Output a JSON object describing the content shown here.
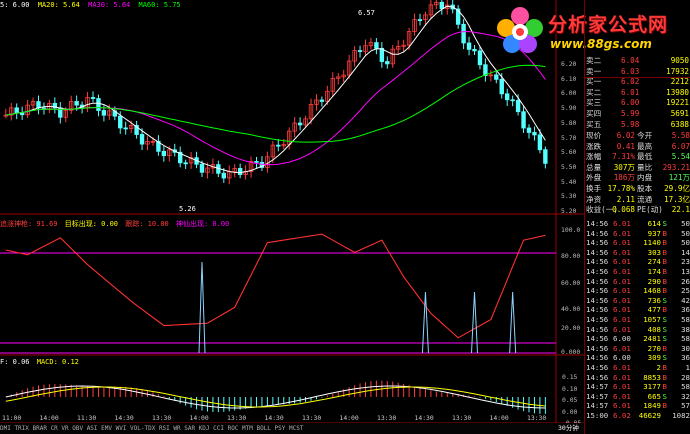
{
  "header": {
    "ma5": "5: 6.00",
    "ma20": "MA20: 5.64",
    "ma30": "MA30: 5.64",
    "ma60": "MA60: 5.75"
  },
  "annotations": {
    "high_label": "6.57",
    "low_label": "5.26"
  },
  "logo": {
    "title": "分析家公式网",
    "url": "www.88gs.com"
  },
  "main_price_axis": [
    "6.20",
    "6.10",
    "6.00",
    "5.90",
    "5.80",
    "5.70",
    "5.60",
    "5.50",
    "5.40",
    "5.30",
    "5.20"
  ],
  "ind1": {
    "label1": "追涨神枪: 91.69",
    "label2": "目标出现: 0.00",
    "label3": "跟踪: 10.00",
    "label4": "神仙出现: 0.00",
    "axis": [
      "100.0",
      "80.00",
      "60.00",
      "40.00",
      "20.00",
      "0.000"
    ]
  },
  "ind2": {
    "label1": "F: 0.06",
    "label2": "MACD: 0.12",
    "axis": [
      "0.15",
      "0.10",
      "0.05",
      "0.00",
      "-0.05"
    ]
  },
  "time_axis": [
    "11:00",
    "14:00",
    "11:30",
    "14:30",
    "13:30",
    "14:00",
    "13:30",
    "14:30",
    "13:30",
    "14:00",
    "13:30",
    "14:30",
    "13:30",
    "14:00",
    "13:30"
  ],
  "bottom_tabs": "DMI TRIX BRAR CR VR OBV ASI EMV WVI VOL-TDX RSI WR SAR KDJ CCI ROC MTM BOLL PSY MCST",
  "period_label": "30分钟",
  "order_book": [
    {
      "label": "卖二",
      "price": "6.04",
      "vol": "9050"
    },
    {
      "label": "卖一",
      "price": "6.03",
      "vol": "17932"
    },
    {
      "label": "买一",
      "price": "6.02",
      "vol": "2212"
    },
    {
      "label": "买二",
      "price": "6.01",
      "vol": "13980"
    },
    {
      "label": "买三",
      "price": "6.00",
      "vol": "19221"
    },
    {
      "label": "买四",
      "price": "5.99",
      "vol": "5691"
    },
    {
      "label": "买五",
      "price": "5.98",
      "vol": "6388"
    }
  ],
  "stats": [
    {
      "l1": "现价",
      "v1": "6.02",
      "l2": "今开",
      "v2": "5.58"
    },
    {
      "l1": "涨跌",
      "v1": "0.41",
      "l2": "最高",
      "v2": "6.07"
    },
    {
      "l1": "涨幅",
      "v1": "7.31%",
      "l2": "最低",
      "v2": "5.54"
    },
    {
      "l1": "总量",
      "v1": "307万",
      "l2": "量比",
      "v2": "293.21"
    },
    {
      "l1": "外盘",
      "v1": "186万",
      "l2": "内盘",
      "v2": "121万"
    },
    {
      "l1": "换手",
      "v1": "17.78%",
      "l2": "股本",
      "v2": "29.9亿"
    },
    {
      "l1": "净资",
      "v1": "2.11",
      "l2": "流通",
      "v2": "17.3亿"
    },
    {
      "l1": "收益(一)",
      "v1": "0.068",
      "l2": "PE(动)",
      "v2": "22.1"
    }
  ],
  "ticks": [
    {
      "t": "14:56",
      "p": "6.01",
      "v": "614",
      "d": "S",
      "n": "50"
    },
    {
      "t": "14:56",
      "p": "6.01",
      "v": "937",
      "d": "B",
      "n": "50"
    },
    {
      "t": "14:56",
      "p": "6.01",
      "v": "1140",
      "d": "B",
      "n": "50"
    },
    {
      "t": "14:56",
      "p": "6.01",
      "v": "303",
      "d": "B",
      "n": "14"
    },
    {
      "t": "14:56",
      "p": "6.01",
      "v": "274",
      "d": "B",
      "n": "23"
    },
    {
      "t": "14:56",
      "p": "6.01",
      "v": "174",
      "d": "B",
      "n": "13"
    },
    {
      "t": "14:56",
      "p": "6.01",
      "v": "290",
      "d": "B",
      "n": "26"
    },
    {
      "t": "14:56",
      "p": "6.01",
      "v": "1468",
      "d": "B",
      "n": "25"
    },
    {
      "t": "14:56",
      "p": "6.01",
      "v": "736",
      "d": "S",
      "n": "42"
    },
    {
      "t": "14:56",
      "p": "6.01",
      "v": "477",
      "d": "B",
      "n": "36"
    },
    {
      "t": "14:56",
      "p": "6.01",
      "v": "1057",
      "d": "S",
      "n": "58"
    },
    {
      "t": "14:56",
      "p": "6.01",
      "v": "408",
      "d": "S",
      "n": "38"
    },
    {
      "t": "14:56",
      "p": "6.00",
      "v": "2481",
      "d": "S",
      "n": "58"
    },
    {
      "t": "14:56",
      "p": "6.01",
      "v": "270",
      "d": "B",
      "n": "30"
    },
    {
      "t": "14:56",
      "p": "6.00",
      "v": "309",
      "d": "S",
      "n": "36"
    },
    {
      "t": "14:56",
      "p": "6.01",
      "v": "2",
      "d": "B",
      "n": "1"
    },
    {
      "t": "14:56",
      "p": "6.01",
      "v": "8853",
      "d": "B",
      "n": "28"
    },
    {
      "t": "14:57",
      "p": "6.01",
      "v": "3177",
      "d": "B",
      "n": "58"
    },
    {
      "t": "14:57",
      "p": "6.01",
      "v": "665",
      "d": "S",
      "n": "32"
    },
    {
      "t": "14:57",
      "p": "6.01",
      "v": "1849",
      "d": "B",
      "n": "57"
    },
    {
      "t": "15:00",
      "p": "6.02",
      "v": "46629",
      "d": "",
      "n": "1082"
    }
  ],
  "colors": {
    "up": "#ff3c3c",
    "down": "#55ffff",
    "ma5": "#ffffff",
    "ma10": "#ffff00",
    "ma20": "#ff00ff",
    "ma60": "#00ff00",
    "grid": "#7a0000"
  }
}
